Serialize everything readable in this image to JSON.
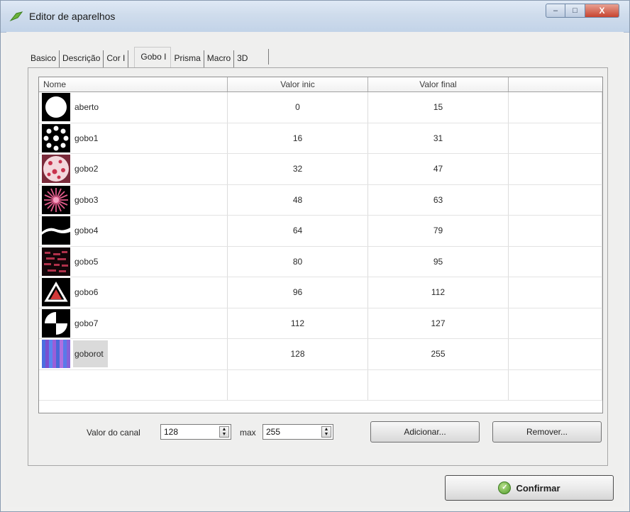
{
  "window": {
    "title": "Editor de aparelhos",
    "controls": {
      "minimize": "–",
      "maximize": "□",
      "close": "X"
    }
  },
  "tabs": [
    {
      "label": "Basico"
    },
    {
      "label": "Descrição"
    },
    {
      "label": "Cor I"
    },
    {
      "label": "Gobo I",
      "active": true
    },
    {
      "label": "Prisma"
    },
    {
      "label": "Macro"
    },
    {
      "label": "3D"
    }
  ],
  "table": {
    "headers": {
      "name": "Nome",
      "start": "Valor inic",
      "end": "Valor final"
    },
    "rows": [
      {
        "name": "aberto",
        "start": "0",
        "end": "15",
        "icon": "open-circle"
      },
      {
        "name": "gobo1",
        "start": "16",
        "end": "31",
        "icon": "dots-ring"
      },
      {
        "name": "gobo2",
        "start": "32",
        "end": "47",
        "icon": "pink-pattern"
      },
      {
        "name": "gobo3",
        "start": "48",
        "end": "63",
        "icon": "starburst"
      },
      {
        "name": "gobo4",
        "start": "64",
        "end": "79",
        "icon": "wave-band"
      },
      {
        "name": "gobo5",
        "start": "80",
        "end": "95",
        "icon": "scatter-red"
      },
      {
        "name": "gobo6",
        "start": "96",
        "end": "112",
        "icon": "triangle"
      },
      {
        "name": "gobo7",
        "start": "112",
        "end": "127",
        "icon": "quadrants"
      },
      {
        "name": "goborot",
        "start": "128",
        "end": "255",
        "icon": "color-stripes",
        "selected": true
      }
    ]
  },
  "controls": {
    "channel_label": "Valor do canal",
    "channel_value": "128",
    "max_label": "max",
    "max_value": "255",
    "add_button": "Adicionar...",
    "remove_button": "Remover...",
    "confirm_button": "Confirmar"
  }
}
